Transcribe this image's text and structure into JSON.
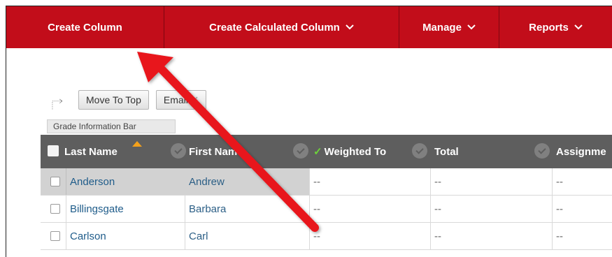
{
  "action_bar": {
    "create_column": "Create Column",
    "create_calculated_column": "Create Calculated Column",
    "manage": "Manage",
    "reports": "Reports",
    "chevron": "⌄"
  },
  "toolbar": {
    "move_to_top": "Move To Top",
    "email": "Email"
  },
  "grade_information_bar": "Grade Information Bar",
  "grid": {
    "columns": [
      "Last Name",
      "First Name",
      "Weighted To",
      "Total",
      "Assignme"
    ],
    "rows": [
      {
        "last": "Anderson",
        "first": "Andrew",
        "weighted": "--",
        "total": "--",
        "assign": "--"
      },
      {
        "last": "Billingsgate",
        "first": "Barbara",
        "weighted": "--",
        "total": "--",
        "assign": "--"
      },
      {
        "last": "Carlson",
        "first": "Carl",
        "weighted": "--",
        "total": "--",
        "assign": "--"
      }
    ]
  },
  "colors": {
    "action_bar": "#c20d1a",
    "header": "#5e5e5e",
    "arrow": "#e8151b"
  },
  "icons": {
    "weighted_check": "✓",
    "move_arrow": "dotted-elbow-arrow-icon",
    "email_chevron": "double-chevron-down-icon"
  }
}
